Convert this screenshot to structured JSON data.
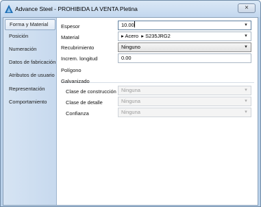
{
  "window": {
    "title": "Advance Steel - PROHIBIDA LA VENTA   Pletina",
    "close_glyph": "×"
  },
  "sidebar": {
    "items": [
      {
        "label": "Forma y Material",
        "active": true
      },
      {
        "label": "Posición"
      },
      {
        "label": "Numeración"
      },
      {
        "label": "Datos de fabricación"
      },
      {
        "label": "Atributos de usuario"
      },
      {
        "label": "Representación"
      },
      {
        "label": "Comportamiento"
      }
    ]
  },
  "form": {
    "espesor": {
      "label": "Espesor",
      "value": "10.00"
    },
    "material": {
      "label": "Material",
      "part1": "Acero",
      "part2": "S235JRG2"
    },
    "recubrimiento": {
      "label": "Recubrimiento",
      "value": "Ninguno"
    },
    "increm": {
      "label": "Increm. longitud",
      "value": "0.00"
    },
    "poligono": {
      "label": "Polígono"
    },
    "galvanizado": {
      "title": "Galvanizado",
      "construccion": {
        "label": "Clase de construcción",
        "value": "Ninguna"
      },
      "detalle": {
        "label": "Clase de detalle",
        "value": "Ninguna"
      },
      "confianza": {
        "label": "Confianza",
        "value": "Ninguna"
      }
    }
  },
  "icons": {
    "dropdown": "▾",
    "arrow_right": "▸"
  }
}
